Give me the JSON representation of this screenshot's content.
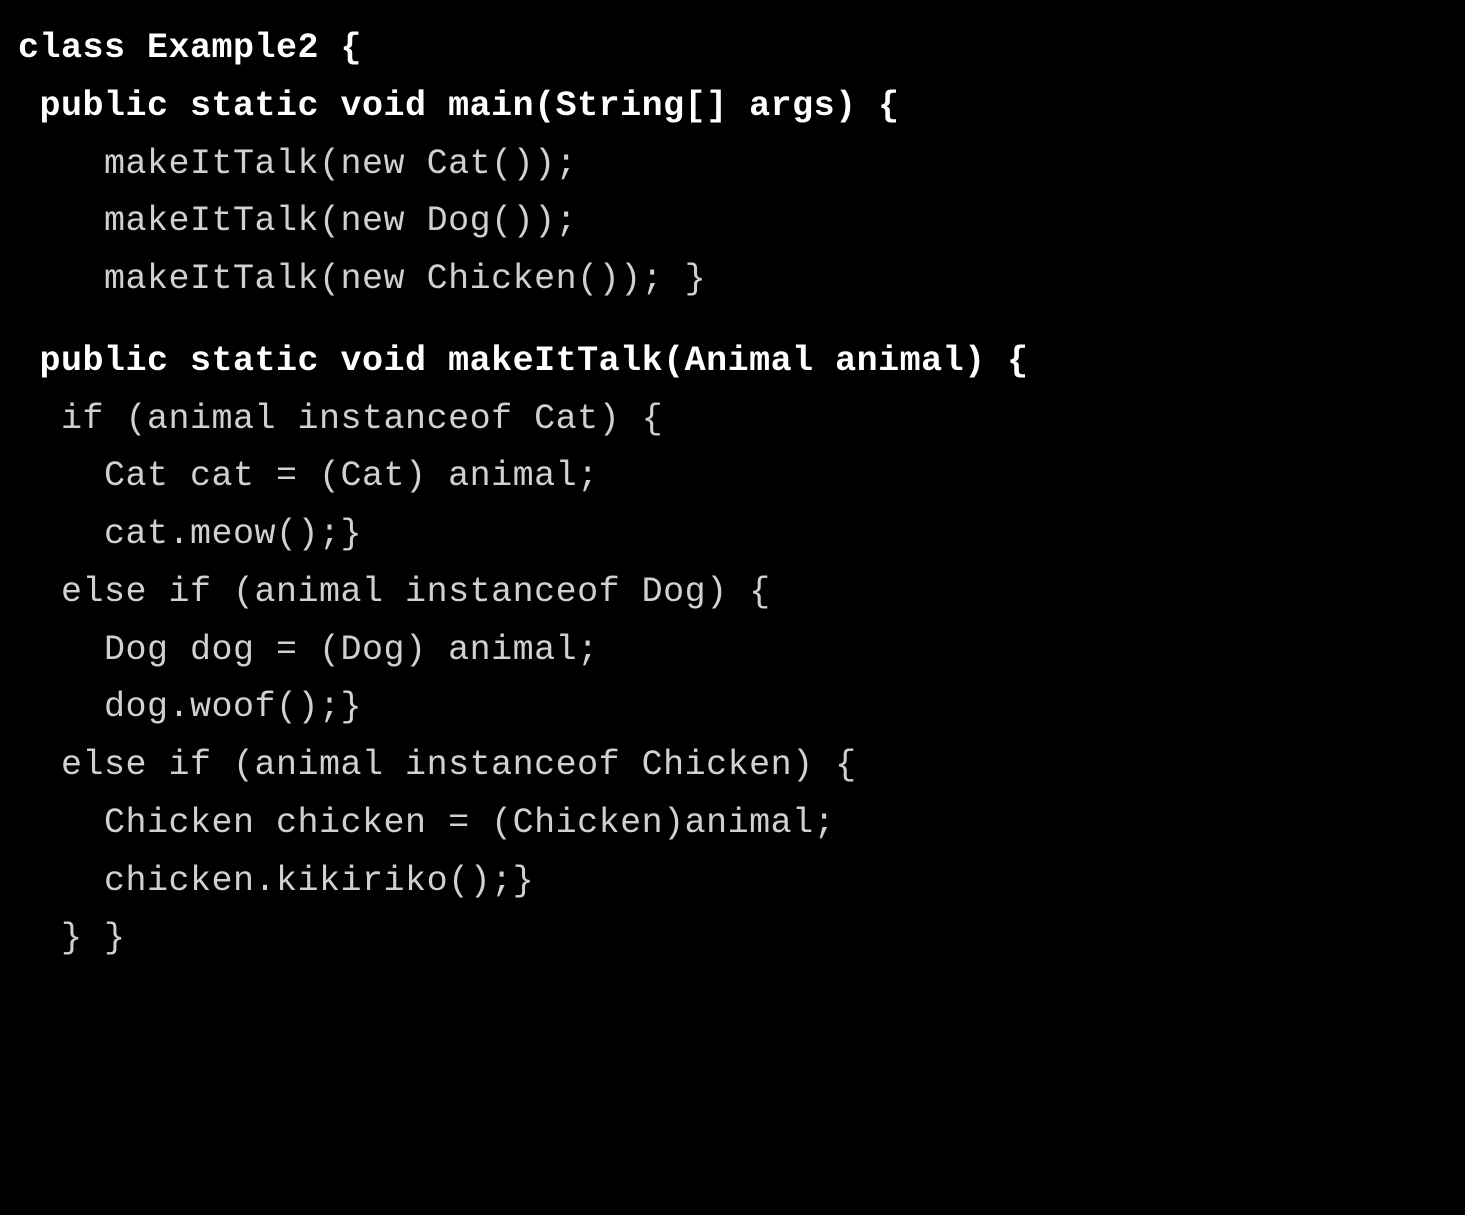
{
  "code": {
    "lines": [
      {
        "text": "class Example2 {",
        "bold": true,
        "indent": 0
      },
      {
        "text": " public static void main(String[] args) {",
        "bold": true,
        "indent": 0
      },
      {
        "text": "    makeItTalk(new Cat());",
        "bold": false,
        "indent": 0
      },
      {
        "text": "    makeItTalk(new Dog());",
        "bold": false,
        "indent": 0
      },
      {
        "text": "    makeItTalk(new Chicken()); }",
        "bold": false,
        "indent": 0,
        "gapAfter": true
      },
      {
        "text": " public static void makeItTalk(Animal animal) {",
        "bold": true,
        "indent": 0
      },
      {
        "text": "  if (animal instanceof Cat) {",
        "bold": false,
        "indent": 0
      },
      {
        "text": "    Cat cat = (Cat) animal;",
        "bold": false,
        "indent": 0
      },
      {
        "text": "    cat.meow();}",
        "bold": false,
        "indent": 0
      },
      {
        "text": "  else if (animal instanceof Dog) {",
        "bold": false,
        "indent": 0
      },
      {
        "text": "    Dog dog = (Dog) animal;",
        "bold": false,
        "indent": 0
      },
      {
        "text": "    dog.woof();}",
        "bold": false,
        "indent": 0
      },
      {
        "text": "  else if (animal instanceof Chicken) {",
        "bold": false,
        "indent": 0
      },
      {
        "text": "    Chicken chicken = (Chicken)animal;",
        "bold": false,
        "indent": 0
      },
      {
        "text": "    chicken.kikiriko();}",
        "bold": false,
        "indent": 0
      },
      {
        "text": "  } }",
        "bold": false,
        "indent": 0
      }
    ]
  }
}
